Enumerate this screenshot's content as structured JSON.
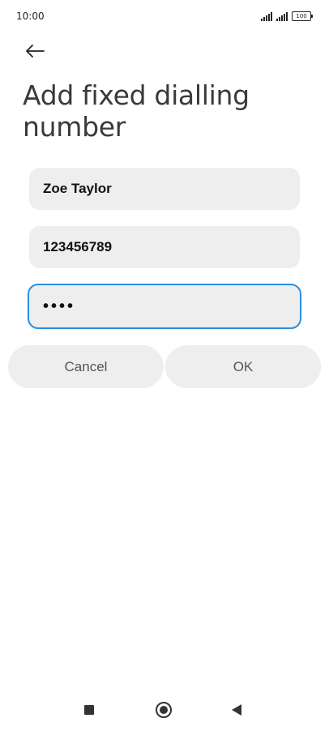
{
  "status_bar": {
    "time": "10:00",
    "battery": "100"
  },
  "header": {
    "title": "Add fixed dialling number"
  },
  "form": {
    "name_value": "Zoe Taylor",
    "number_value": "123456789",
    "pin_value": "••••"
  },
  "buttons": {
    "cancel_label": "Cancel",
    "ok_label": "OK"
  },
  "colors": {
    "accent": "#2b8fe0",
    "field_background": "#eeeeee"
  },
  "icons": {
    "back": "arrow-left-icon",
    "nav_recents": "square-icon",
    "nav_home": "circle-icon",
    "nav_back": "triangle-back-icon"
  }
}
